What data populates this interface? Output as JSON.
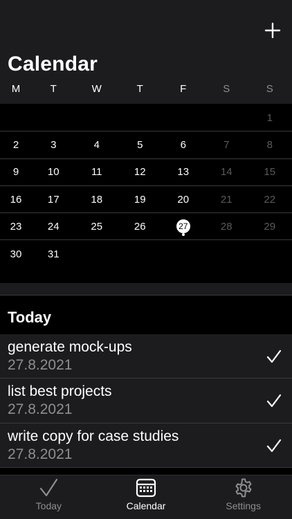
{
  "header": {
    "title": "Calendar",
    "add_icon": "plus-icon"
  },
  "weekdays": [
    "M",
    "T",
    "W",
    "T",
    "F",
    "S",
    "S"
  ],
  "calendar": {
    "today": "27",
    "weeks": [
      [
        "",
        "",
        "",
        "",
        "",
        "",
        "1"
      ],
      [
        "2",
        "3",
        "4",
        "5",
        "6",
        "7",
        "8"
      ],
      [
        "9",
        "10",
        "11",
        "12",
        "13",
        "14",
        "15"
      ],
      [
        "16",
        "17",
        "18",
        "19",
        "20",
        "21",
        "22"
      ],
      [
        "23",
        "24",
        "25",
        "26",
        "27",
        "28",
        "29"
      ],
      [
        "30",
        "31",
        "",
        "",
        "",
        "",
        ""
      ]
    ]
  },
  "today_section": {
    "title": "Today",
    "items": [
      {
        "title": "generate mock-ups",
        "date": "27.8.2021",
        "icon": "checkmark-icon"
      },
      {
        "title": "list best projects",
        "date": "27.8.2021",
        "icon": "checkmark-icon"
      },
      {
        "title": "write copy for case studies",
        "date": "27.8.2021",
        "icon": "checkmark-icon"
      }
    ]
  },
  "tabbar": {
    "tabs": [
      {
        "label": "Today",
        "icon": "checkmark-icon",
        "active": false
      },
      {
        "label": "Calendar",
        "icon": "calendar-icon",
        "active": true
      },
      {
        "label": "Settings",
        "icon": "gear-icon",
        "active": false
      }
    ]
  },
  "colors": {
    "background": "#000000",
    "surface": "#1c1c1e",
    "muted": "#8e8e93",
    "separator": "#3a3a3c"
  }
}
